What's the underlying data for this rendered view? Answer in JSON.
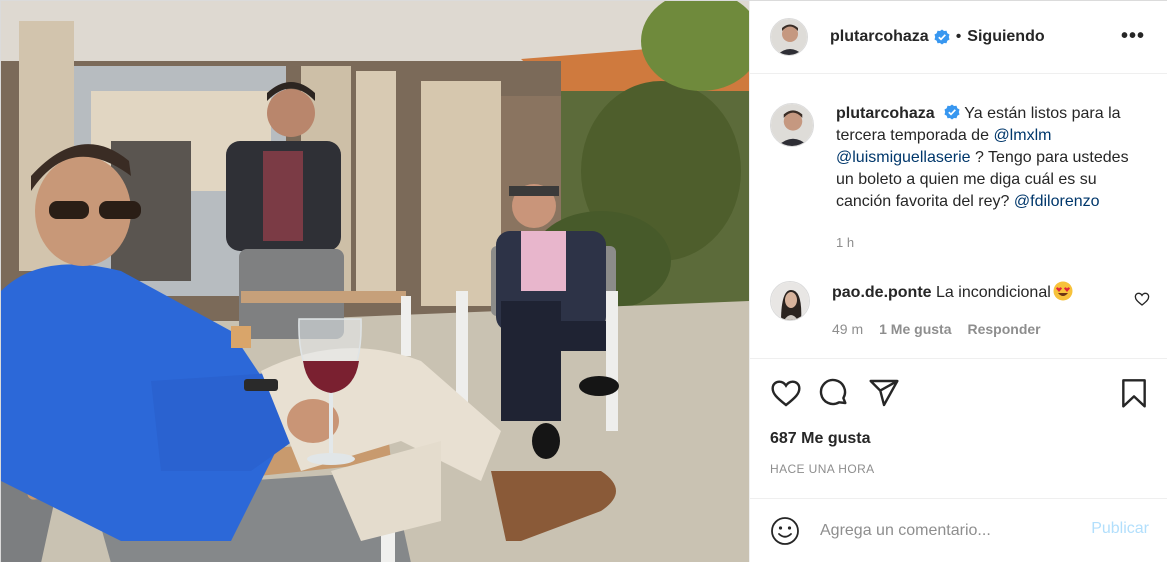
{
  "post": {
    "photo": {
      "icon": "group-photo-image"
    },
    "header": {
      "username": "plutarcohaza",
      "verified_icon": "verified-badge-icon",
      "separator": "•",
      "follow_status": "Siguiendo",
      "more_label": "•••"
    },
    "caption": {
      "username": "plutarcohaza",
      "text_1": "Ya están listos para la tercera temporada de",
      "mention_1": "@lmxlm",
      "mention_2": "@luismiguellaserie",
      "text_2": "? Tengo para ustedes un boleto a quien me diga cuál es su canción favorita del rey?",
      "mention_3": "@fdilorenzo",
      "time": "1 h"
    },
    "comment": {
      "username": "pao.de.ponte",
      "text": "La incondicional",
      "emoji_icon": "heart-eyes-emoji-icon",
      "time": "49 m",
      "likes": "1 Me gusta",
      "reply": "Responder"
    },
    "actions": {
      "like_icon": "heart-icon",
      "comment_icon": "comment-icon",
      "share_icon": "send-icon",
      "save_icon": "bookmark-icon"
    },
    "likes_count": "687 Me gusta",
    "timestamp": "HACE UNA HORA",
    "add_comment": {
      "placeholder": "Agrega un comentario...",
      "publish_label": "Publicar"
    },
    "colors": {
      "link": "#00376b",
      "verified": "#3897f0",
      "publish_disabled": "#b2dffc",
      "secondary_text": "#8e8e8e"
    }
  }
}
